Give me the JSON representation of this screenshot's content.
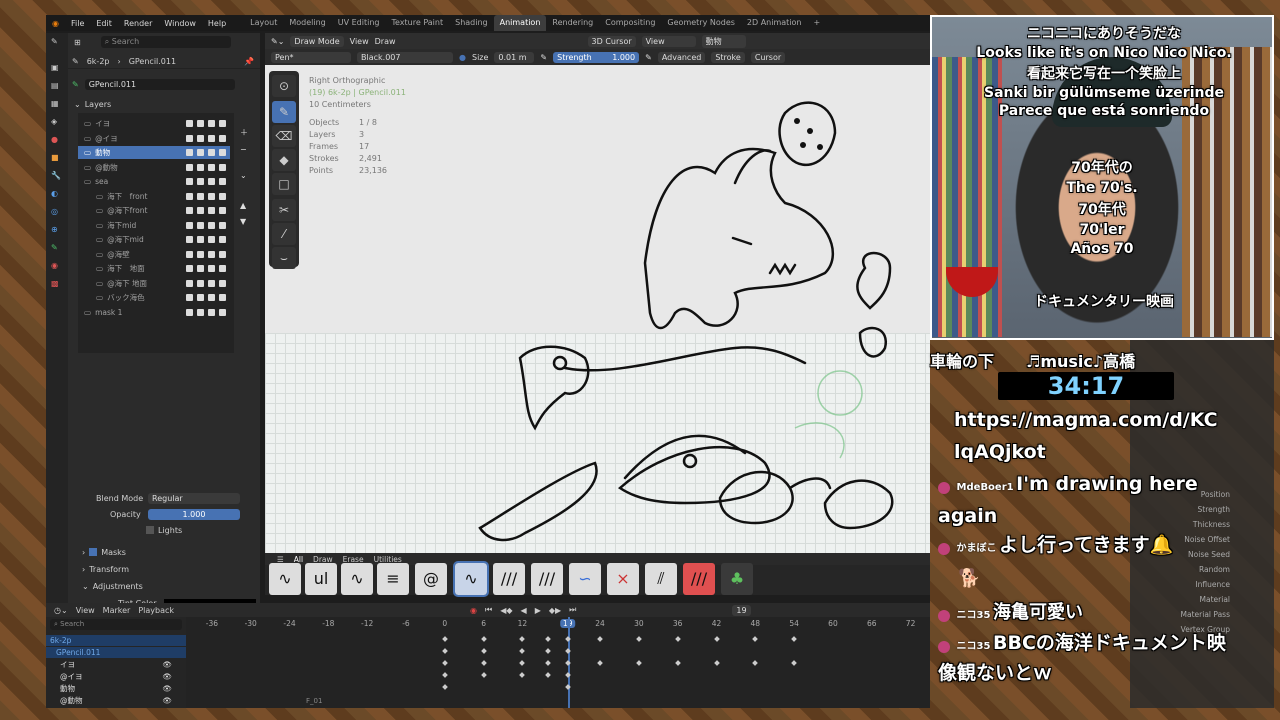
{
  "menu": {
    "file": "File",
    "edit": "Edit",
    "render": "Render",
    "window": "Window",
    "help": "Help"
  },
  "workspaces": [
    "Layout",
    "Modeling",
    "UV Editing",
    "Texture Paint",
    "Shading",
    "Animation",
    "Rendering",
    "Compositing",
    "Geometry Nodes",
    "2D Animation"
  ],
  "active_workspace": "Animation",
  "properties": {
    "search_placeholder": "Search",
    "scene": "6k-2p",
    "object": "GPencil.011",
    "data": "GPencil.011",
    "layers_title": "Layers",
    "layers": [
      {
        "name": "イヨ",
        "sel": false
      },
      {
        "name": "@イヨ",
        "sel": false
      },
      {
        "name": "動物",
        "sel": true
      },
      {
        "name": "@動物",
        "sel": false
      },
      {
        "name": "sea",
        "sel": false
      },
      {
        "name": "海下　front",
        "sel": false
      },
      {
        "name": "@海下front",
        "sel": false
      },
      {
        "name": "海下mid",
        "sel": false
      },
      {
        "name": "@海下mid",
        "sel": false
      },
      {
        "name": "@海壁",
        "sel": false
      },
      {
        "name": "海下　地面",
        "sel": false
      },
      {
        "name": "@海下 地面",
        "sel": false
      },
      {
        "name": "バック海色",
        "sel": false
      },
      {
        "name": "mask 1",
        "sel": false
      }
    ],
    "blend_mode_label": "Blend Mode",
    "blend_mode": "Regular",
    "opacity_label": "Opacity",
    "opacity": "1.000",
    "lights": "Lights",
    "masks": "Masks",
    "transform": "Transform",
    "adjustments": "Adjustments",
    "tint_color": "Tint Color"
  },
  "viewport": {
    "mode": "Draw Mode",
    "view": "View",
    "draw": "Draw",
    "pivot": "3D Cursor",
    "view2": "View",
    "layer": "動物",
    "brush": "Pen*",
    "material": "Black.007",
    "size_label": "Size",
    "size": "0.01 m",
    "strength_label": "Strength",
    "strength": "1.000",
    "advanced": "Advanced",
    "stroke": "Stroke",
    "cursor": "Cursor",
    "overlay_view": "Right Orthographic",
    "overlay_obj": "(19) 6k-2p | GPencil.011",
    "overlay_scale": "10 Centimeters",
    "stats": [
      {
        "k": "Objects",
        "v": "1 / 8"
      },
      {
        "k": "Layers",
        "v": "3"
      },
      {
        "k": "Frames",
        "v": "17"
      },
      {
        "k": "Strokes",
        "v": "2,491"
      },
      {
        "k": "Points",
        "v": "23,136"
      }
    ]
  },
  "brush_tabs": [
    "All",
    "Draw",
    "Erase",
    "Utilities"
  ],
  "timeline": {
    "view": "View",
    "marker": "Marker",
    "playback": "Playback",
    "current_frame": "19",
    "search_placeholder": "Search",
    "ticks": [
      "-36",
      "-30",
      "-24",
      "-18",
      "-12",
      "-6",
      "0",
      "6",
      "12",
      "19",
      "24",
      "30",
      "36",
      "42",
      "48",
      "54",
      "60",
      "66",
      "72"
    ],
    "tracks": [
      "6k-2p",
      "GPencil.011",
      "イヨ",
      "@イヨ",
      "動物",
      "@動物"
    ],
    "frame_label": "F_01"
  },
  "captions": {
    "line1": "ニコニコにありそうだな",
    "line2": "Looks like it's on Nico Nico Nico.",
    "line3": "看起来它写在一个笑脸上",
    "line4": "Sanki bir gülümseme üzerinde",
    "line5": "Parece que está sonriendo",
    "line6": "70年代の",
    "line7": "The 70's.",
    "line8": "70年代",
    "line9": "70'ler",
    "line10": "Años 70",
    "line11": "ドキュメンタリー映画"
  },
  "chat": {
    "music": "車輪の下　　♬music♪高橋",
    "timer": "34:17",
    "url": "https://magma.com/d/KClqAQjkot",
    "messages": [
      {
        "user": "MdeBoer1",
        "text": "I'm drawing here again"
      },
      {
        "user": "かまぼこ",
        "text": "よし行ってきます🔔"
      },
      {
        "user": "ニコ35",
        "text": "海亀可愛い"
      },
      {
        "user": "ニコ35",
        "text": "BBCの海洋ドキュメント映像観ないとｗ"
      }
    ],
    "side_labels": [
      "Position",
      "Strength",
      "Thickness",
      "Noise Offset",
      "Noise Seed",
      "Random",
      "Influence",
      "Material",
      "Material Pass",
      "Vertex Group"
    ]
  }
}
